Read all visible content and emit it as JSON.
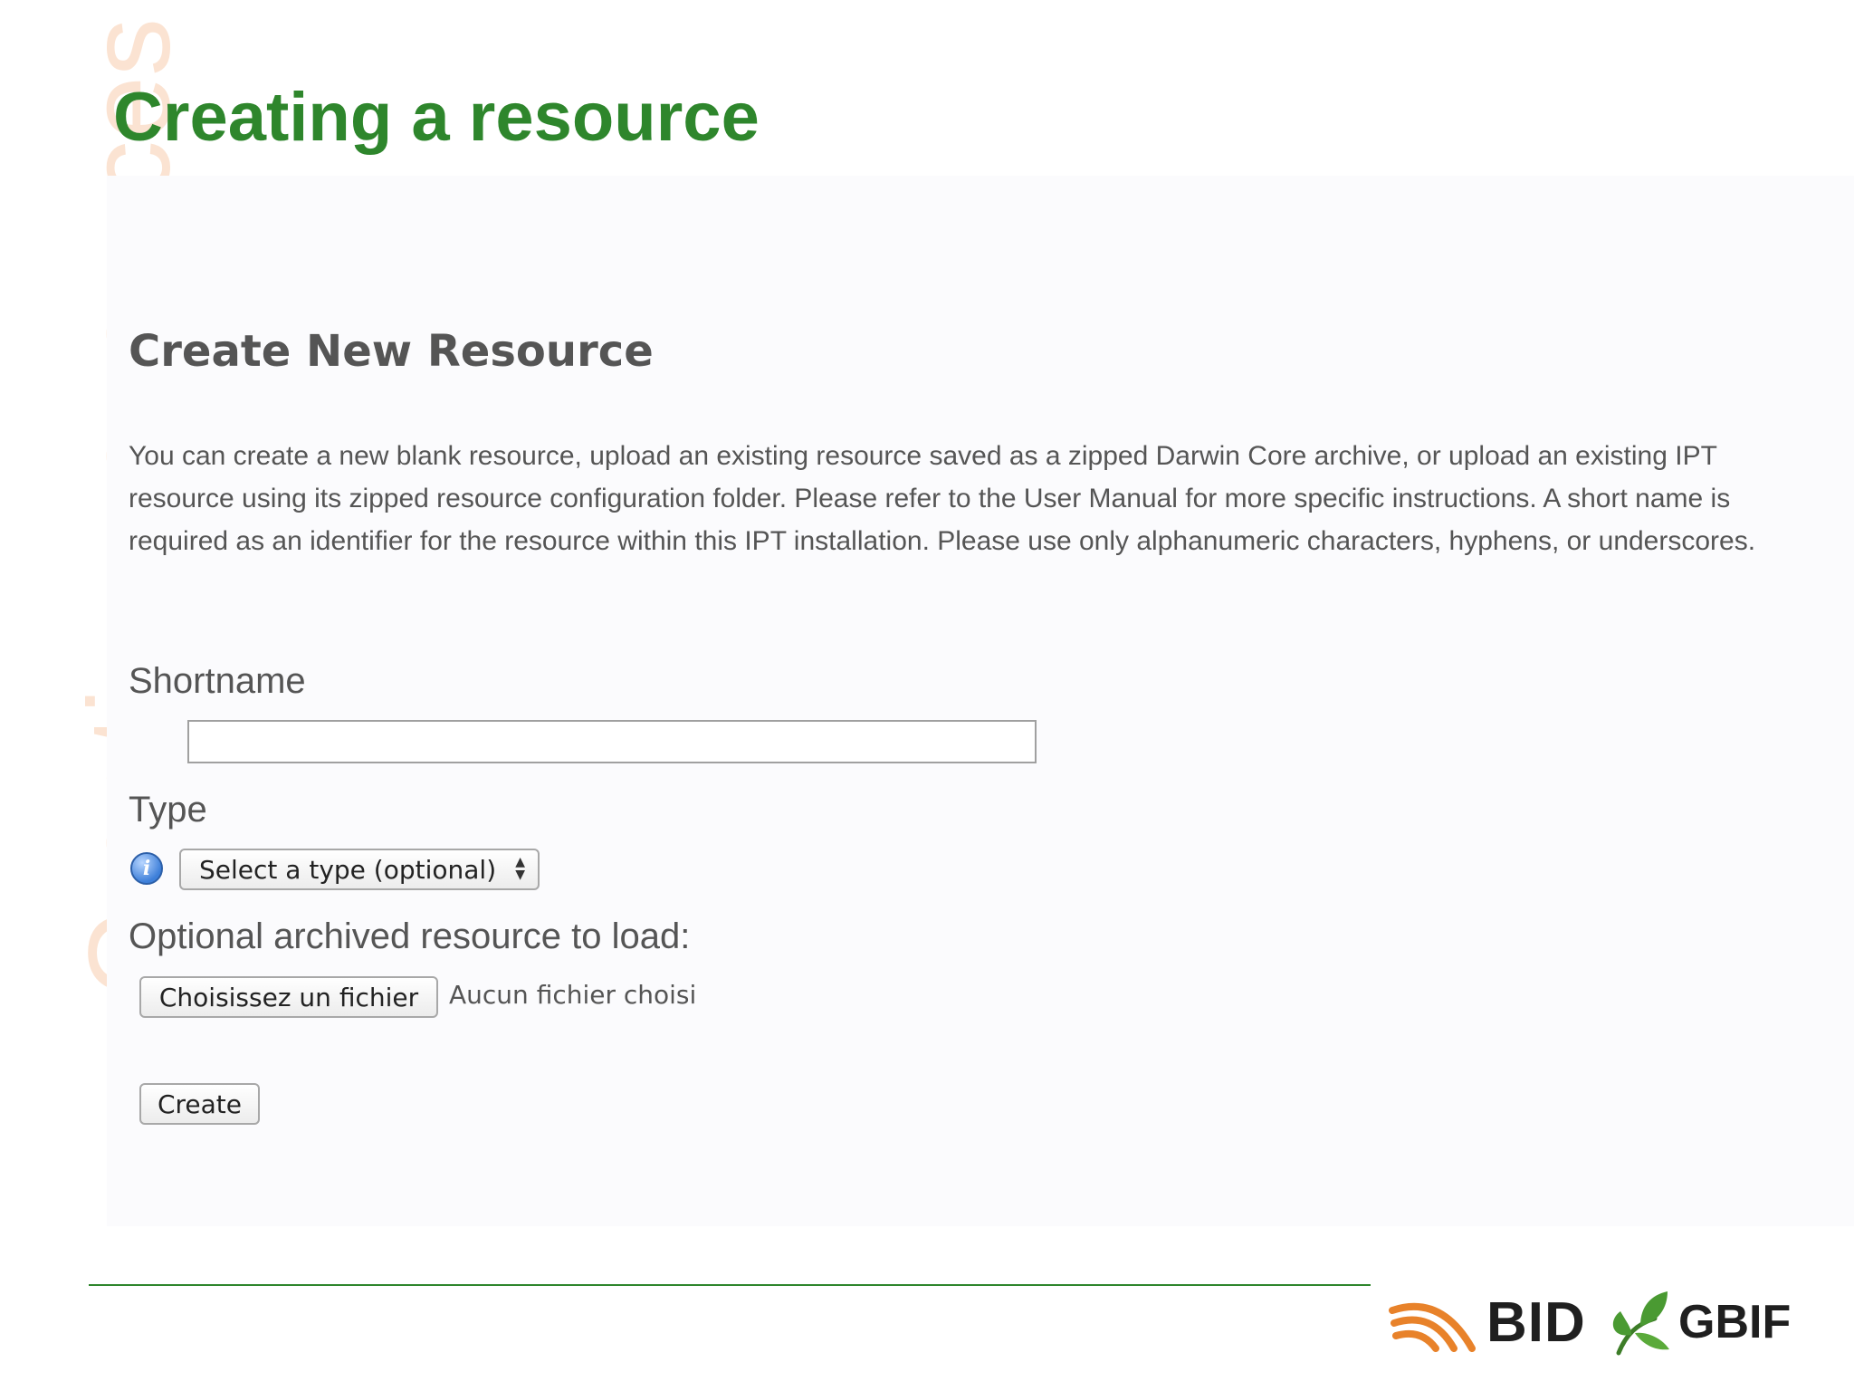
{
  "slide": {
    "side_title": "Creating resources",
    "title": "Creating a resource"
  },
  "form": {
    "heading": "Create New Resource",
    "intro": "You can create a new blank resource, upload an existing resource saved as a zipped Darwin Core archive, or upload an existing IPT resource using its zipped resource configuration folder. Please refer to the User Manual for more specific instructions. A short name is required as an identifier for the resource within this IPT installation. Please use only alphanumeric characters, hyphens, or underscores.",
    "shortname_label": "Shortname",
    "shortname_value": "",
    "type_label": "Type",
    "type_select_value": "Select a type (optional)",
    "archive_label": "Optional archived resource to load:",
    "file_button_label": "Choisissez un fichier",
    "file_status": "Aucun fichier choisi",
    "create_button_label": "Create"
  },
  "footer": {
    "logo_bid": "BID",
    "logo_gbif": "GBIF"
  },
  "colors": {
    "title_green": "#2e862c",
    "side_title_peach": "#fbe3d2",
    "bid_orange": "#e8822a",
    "gbif_green": "#4a9a32"
  },
  "icons": {
    "info": "info-icon",
    "select_arrows": "select-arrows-icon"
  }
}
